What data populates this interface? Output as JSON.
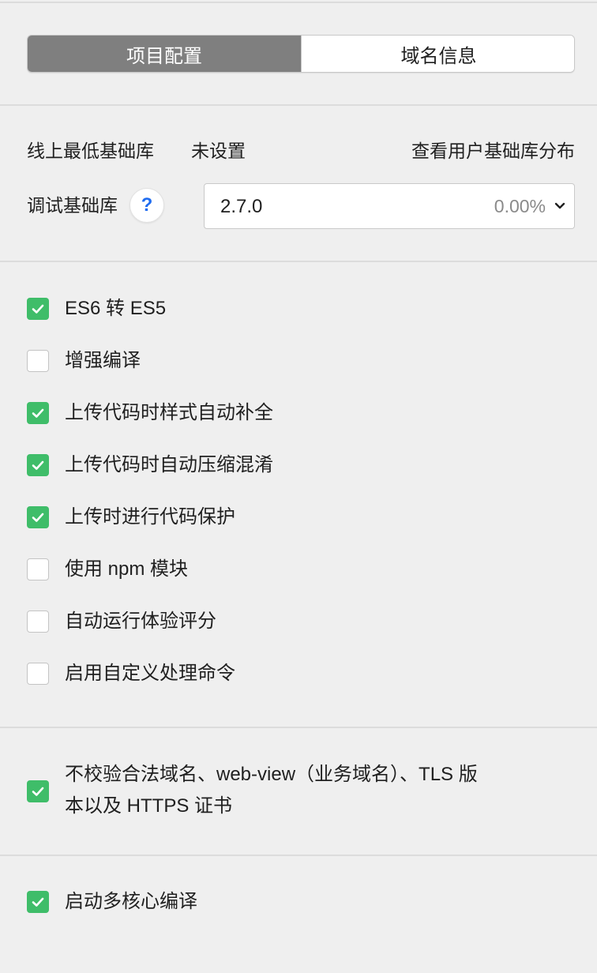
{
  "tabs": [
    {
      "label": "项目配置",
      "active": true
    },
    {
      "label": "域名信息",
      "active": false
    }
  ],
  "base_lib": {
    "online_min_label": "线上最低基础库",
    "online_min_value": "未设置",
    "view_distribution_link": "查看用户基础库分布",
    "debug_label": "调试基础库",
    "help_glyph": "?",
    "selected_version": "2.7.0",
    "selected_percent": "0.00%"
  },
  "options": [
    {
      "label": "ES6 转 ES5",
      "checked": true
    },
    {
      "label": "增强编译",
      "checked": false
    },
    {
      "label": "上传代码时样式自动补全",
      "checked": true
    },
    {
      "label": "上传代码时自动压缩混淆",
      "checked": true
    },
    {
      "label": "上传时进行代码保护",
      "checked": true
    },
    {
      "label": "使用 npm 模块",
      "checked": false
    },
    {
      "label": "自动运行体验评分",
      "checked": false
    },
    {
      "label": "启用自定义处理命令",
      "checked": false
    }
  ],
  "domain_option": {
    "line1": "不校验合法域名、web-view（业务域名）、TLS 版",
    "line2": "本以及 HTTPS 证书",
    "checked": true
  },
  "multicore_option": {
    "label": "启动多核心编译",
    "checked": true
  },
  "colors": {
    "checked": "#3fbd69",
    "active_tab": "#7f7f7f",
    "help": "#1f6cf0"
  }
}
